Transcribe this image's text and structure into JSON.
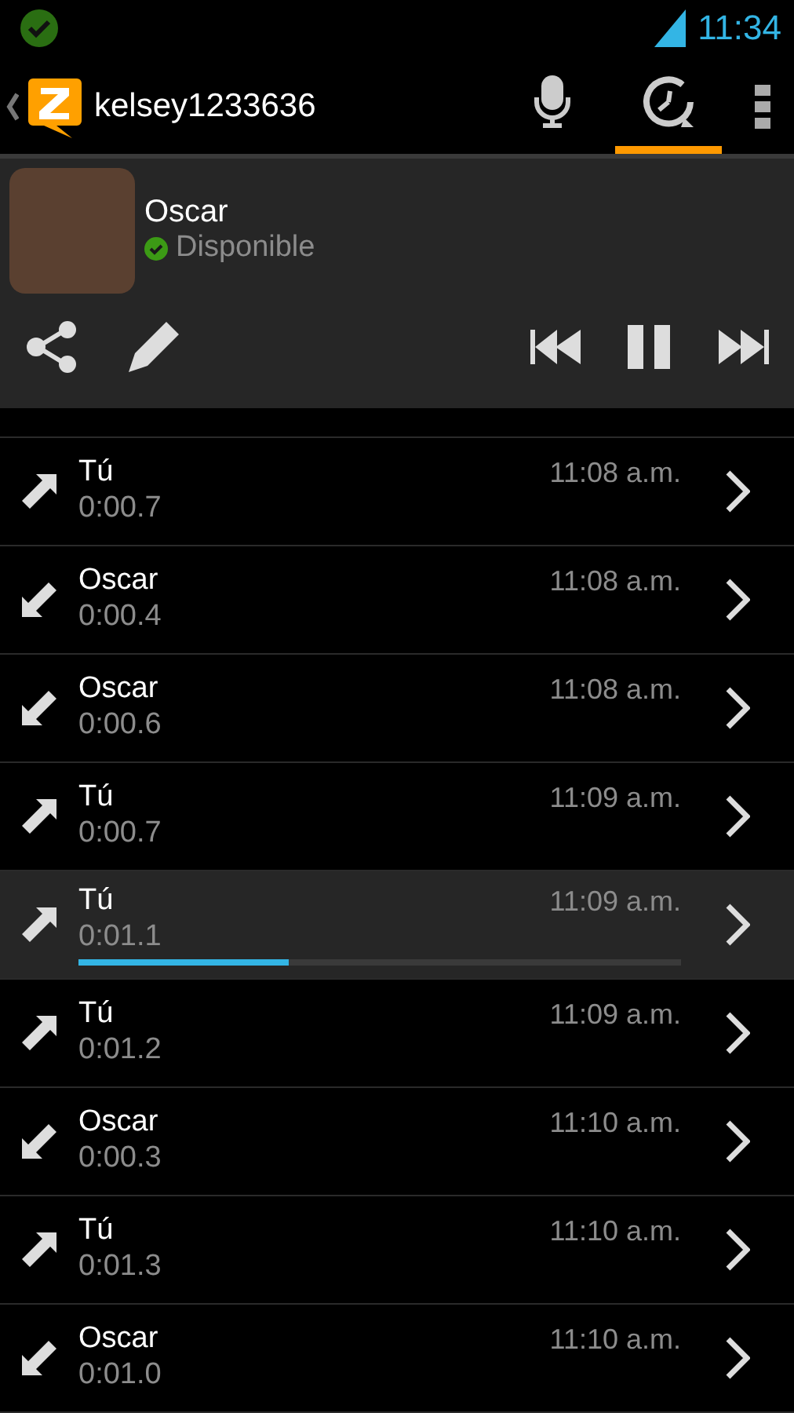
{
  "status_bar": {
    "time": "11:34"
  },
  "action_bar": {
    "title": "kelsey1233636",
    "tabs": [
      {
        "kind": "mic",
        "selected": false
      },
      {
        "kind": "history",
        "selected": true
      }
    ]
  },
  "contact": {
    "name": "Oscar",
    "status": "Disponible"
  },
  "player": {
    "playing": true
  },
  "messages": [
    {
      "kind": "outgoing",
      "sender": "Tú",
      "duration": "0:00.7",
      "time": "11:08 a.m.",
      "selected": false
    },
    {
      "kind": "incoming",
      "sender": "Oscar",
      "duration": "0:00.4",
      "time": "11:08 a.m.",
      "selected": false
    },
    {
      "kind": "incoming",
      "sender": "Oscar",
      "duration": "0:00.6",
      "time": "11:08 a.m.",
      "selected": false
    },
    {
      "kind": "outgoing",
      "sender": "Tú",
      "duration": "0:00.7",
      "time": "11:09 a.m.",
      "selected": false
    },
    {
      "kind": "outgoing",
      "sender": "Tú",
      "duration": "0:01.1",
      "time": "11:09 a.m.",
      "selected": true,
      "level": 0.35
    },
    {
      "kind": "outgoing",
      "sender": "Tú",
      "duration": "0:01.2",
      "time": "11:09 a.m.",
      "selected": false
    },
    {
      "kind": "incoming",
      "sender": "Oscar",
      "duration": "0:00.3",
      "time": "11:10 a.m.",
      "selected": false
    },
    {
      "kind": "outgoing",
      "sender": "Tú",
      "duration": "0:01.3",
      "time": "11:10 a.m.",
      "selected": false
    },
    {
      "kind": "incoming",
      "sender": "Oscar",
      "duration": "0:01.0",
      "time": "11:10 a.m.",
      "selected": false
    }
  ]
}
